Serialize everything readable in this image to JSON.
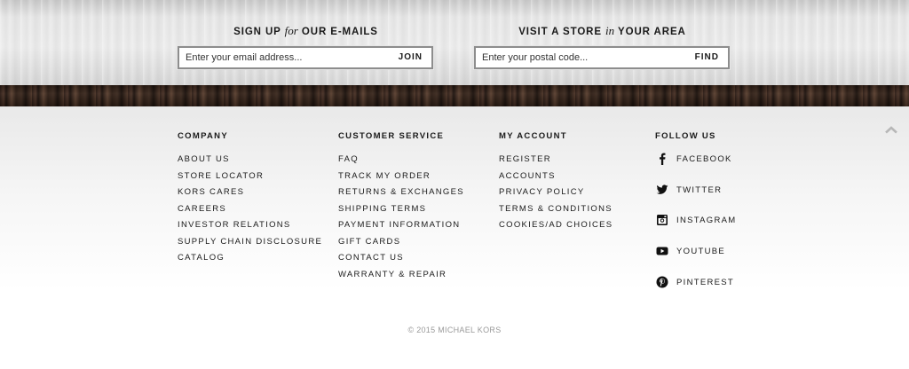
{
  "signup": {
    "email": {
      "title_pre": "SIGN UP ",
      "title_em": "for",
      "title_post": " OUR E-MAILS",
      "placeholder": "Enter your email address...",
      "button": "JOIN"
    },
    "store": {
      "title_pre": "VISIT A STORE ",
      "title_em": "in",
      "title_post": " YOUR AREA",
      "placeholder": "Enter your postal code...",
      "button": "FIND"
    }
  },
  "footer": {
    "company": {
      "heading": "COMPANY",
      "links": [
        "ABOUT US",
        "STORE LOCATOR",
        "KORS CARES",
        "CAREERS",
        "INVESTOR RELATIONS",
        "SUPPLY CHAIN DISCLOSURE",
        "CATALOG"
      ]
    },
    "customer_service": {
      "heading": "CUSTOMER SERVICE",
      "links": [
        "FAQ",
        "TRACK MY ORDER",
        "RETURNS & EXCHANGES",
        "SHIPPING TERMS",
        "PAYMENT INFORMATION",
        "GIFT CARDS",
        "CONTACT US",
        "WARRANTY & REPAIR"
      ]
    },
    "my_account": {
      "heading": "MY ACCOUNT",
      "links": [
        "REGISTER",
        "ACCOUNTS",
        "PRIVACY POLICY",
        "TERMS & CONDITIONS",
        "COOKIES/AD CHOICES"
      ]
    },
    "follow_us": {
      "heading": "FOLLOW US",
      "links": [
        {
          "label": "FACEBOOK",
          "icon": "facebook-icon"
        },
        {
          "label": "TWITTER",
          "icon": "twitter-icon"
        },
        {
          "label": "INSTAGRAM",
          "icon": "instagram-icon"
        },
        {
          "label": "YOUTUBE",
          "icon": "youtube-icon"
        },
        {
          "label": "PINTEREST",
          "icon": "pinterest-icon"
        }
      ]
    },
    "scroll_top_icon": "chevron-up-icon",
    "copyright": "© 2015 MICHAEL KORS"
  },
  "colors": {
    "text": "#1a1a1a",
    "copyright": "#9a9a9a",
    "wood": "#2e1f17",
    "field_border": "#8d8d8d"
  }
}
